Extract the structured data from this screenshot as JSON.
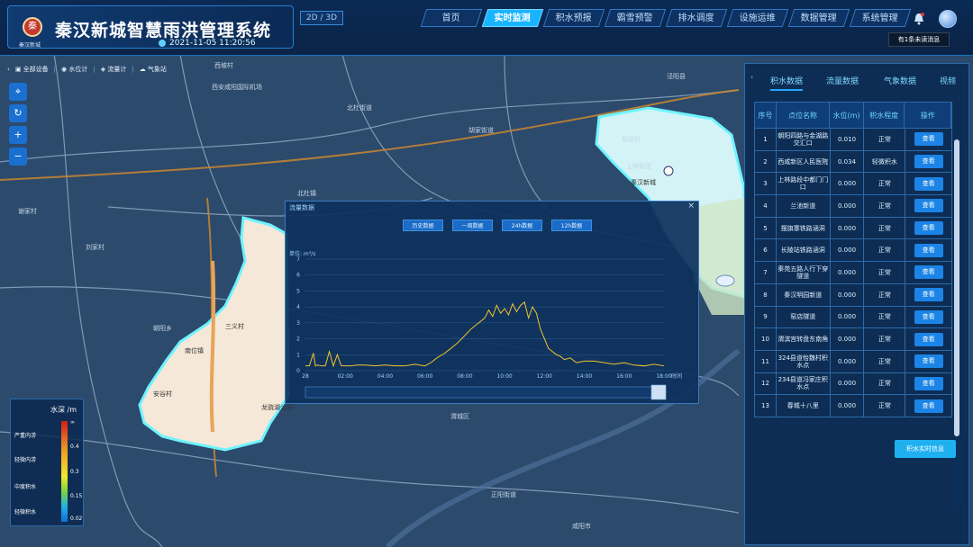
{
  "header": {
    "title": "秦汉新城智慧雨洪管理系统",
    "logo_sub": "秦汉新城",
    "clock": "2021-11-05 11:20:56",
    "view_toggle": "2D / 3D",
    "nav": [
      {
        "label": "首页",
        "active": false
      },
      {
        "label": "实时监测",
        "active": true
      },
      {
        "label": "积水预报",
        "active": false
      },
      {
        "label": "霸雪预警",
        "active": false
      },
      {
        "label": "排水调度",
        "active": false
      },
      {
        "label": "设施运维",
        "active": false
      },
      {
        "label": "数据管理",
        "active": false
      },
      {
        "label": "系统管理",
        "active": false
      }
    ],
    "tooltip": "有1条未读消息"
  },
  "layerbar": {
    "items": [
      "全部设备",
      "水位计",
      "流量计",
      "气象站"
    ]
  },
  "legend": {
    "title": "水深 /m",
    "labels": [
      "严重内涝",
      "轻微内涝",
      "中度积水",
      "轻微积水"
    ],
    "values": [
      "∞",
      "0.4",
      "0.3",
      "0.15",
      "0.02"
    ]
  },
  "popup": {
    "title": "流量数据",
    "close": "×",
    "buttons": [
      "历史数据",
      "一周数据",
      "24h数据",
      "12h数据"
    ],
    "y_unit": "单位: m³/s",
    "x_unit": "时间"
  },
  "chart_data": {
    "type": "line",
    "title": "",
    "xlabel": "时间",
    "ylabel": "单位: m³/s",
    "ylim": [
      0,
      7
    ],
    "yticks": [
      "0",
      "1",
      "2",
      "3",
      "4",
      "5",
      "6",
      "7"
    ],
    "xticks": [
      "28",
      "02:00",
      "04:00",
      "06:00",
      "08:00",
      "10:00",
      "12:00",
      "14:00",
      "16:00",
      "18:00"
    ],
    "series": [
      {
        "color": "#f2c42a",
        "x": [
          0,
          0.2,
          0.4,
          0.5,
          0.6,
          0.8,
          1.0,
          1.2,
          1.4,
          1.6,
          1.8,
          2.0,
          2.3,
          2.6,
          3.0,
          3.5,
          4.0,
          4.5,
          5.0,
          5.5,
          6.0,
          6.3,
          6.6,
          7.0,
          7.3,
          7.6,
          8.0,
          8.3,
          8.6,
          9.0,
          9.2,
          9.4,
          9.6,
          9.8,
          10.0,
          10.2,
          10.4,
          10.6,
          10.8,
          11.0,
          11.2,
          11.4,
          11.6,
          11.8,
          12.0,
          12.2,
          12.4,
          12.6,
          12.8,
          13.0,
          13.3,
          13.6,
          14.0,
          14.5,
          15.0,
          15.5,
          16.0,
          16.5,
          17.0,
          17.5,
          18.0
        ],
        "y": [
          0.3,
          0.3,
          1.1,
          0.3,
          0.35,
          0.3,
          0.3,
          1.2,
          0.3,
          1.0,
          0.3,
          0.3,
          0.3,
          0.35,
          0.35,
          0.3,
          0.35,
          0.3,
          0.3,
          0.4,
          0.3,
          0.5,
          0.8,
          1.1,
          1.4,
          1.7,
          2.2,
          2.6,
          2.9,
          3.3,
          3.8,
          3.4,
          4.1,
          3.6,
          3.9,
          3.5,
          4.2,
          3.7,
          4.1,
          4.3,
          3.3,
          4.0,
          3.6,
          2.6,
          2.0,
          1.4,
          1.2,
          1.0,
          0.9,
          0.7,
          0.8,
          0.5,
          0.6,
          0.6,
          0.5,
          0.4,
          0.5,
          0.35,
          0.3,
          0.4,
          0.3
        ]
      }
    ]
  },
  "rpanel": {
    "tabs": [
      "积水数据",
      "流量数据",
      "气象数据",
      "视频"
    ],
    "columns": [
      "序号",
      "点位名称",
      "水位(m)",
      "积水程度",
      "操作"
    ],
    "rows": [
      {
        "no": "1",
        "name": "朝阳四路与金湖路交汇口",
        "level": "0.010",
        "status": "正常",
        "op": "查看"
      },
      {
        "no": "2",
        "name": "西咸新区人民医院",
        "level": "0.034",
        "status": "轻微积水",
        "op": "查看"
      },
      {
        "no": "3",
        "name": "上林路段中都门门口",
        "level": "0.000",
        "status": "正常",
        "op": "查看"
      },
      {
        "no": "4",
        "name": "兰池新道",
        "level": "0.000",
        "status": "正常",
        "op": "查看"
      },
      {
        "no": "5",
        "name": "摆旗寨铁路涵洞",
        "level": "0.000",
        "status": "正常",
        "op": "查看"
      },
      {
        "no": "6",
        "name": "长陵站铁路涵洞",
        "level": "0.000",
        "status": "正常",
        "op": "查看"
      },
      {
        "no": "7",
        "name": "秦苑五路人行下穿隧道",
        "level": "0.000",
        "status": "正常",
        "op": "查看"
      },
      {
        "no": "8",
        "name": "秦汉明园新道",
        "level": "0.000",
        "status": "正常",
        "op": "查看"
      },
      {
        "no": "9",
        "name": "窑店隧道",
        "level": "0.000",
        "status": "正常",
        "op": "查看"
      },
      {
        "no": "10",
        "name": "渭滨宫转盘东南角",
        "level": "0.000",
        "status": "正常",
        "op": "查看"
      },
      {
        "no": "11",
        "name": "324县道怡魏村积水点",
        "level": "0.000",
        "status": "正常",
        "op": "查看"
      },
      {
        "no": "12",
        "name": "234县道冯家庄积水点",
        "level": "0.000",
        "status": "正常",
        "op": "查看"
      },
      {
        "no": "13",
        "name": "春城十八里",
        "level": "0.000",
        "status": "正常",
        "op": "查看"
      }
    ],
    "realtime_button": "积水实时信息"
  },
  "map": {
    "places": [
      "西坡村",
      "西安咸阳国际机场",
      "北杜街道",
      "刘家村",
      "朝阳乡",
      "胡家街道",
      "窑店村",
      "上林街道",
      "正阳街道",
      "咸阳市",
      "龙骁湖公园",
      "渭城区",
      "三义村",
      "南位镇",
      "秦汉新城",
      "安谷村",
      "谢家村",
      "北杜镇",
      "泾阳县"
    ]
  }
}
